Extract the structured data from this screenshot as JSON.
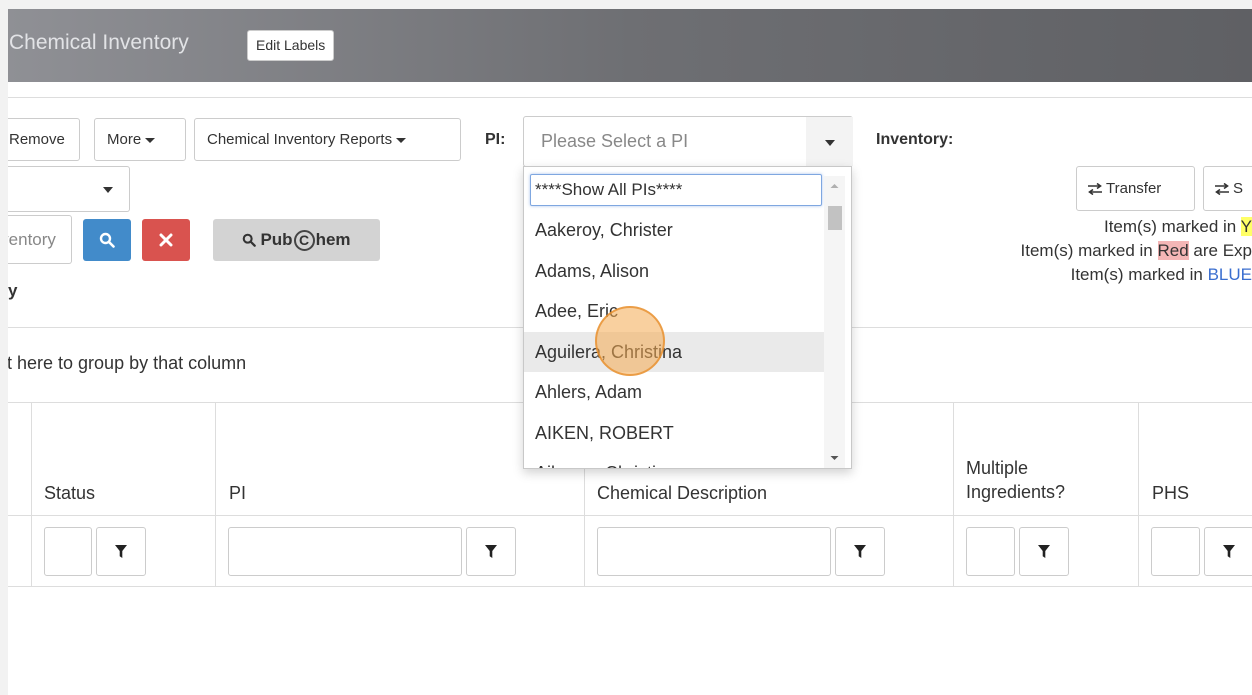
{
  "header": {
    "title": "Chemical Inventory",
    "edit_labels": "Edit Labels"
  },
  "toolbar": {
    "remove": "Remove",
    "more": "More",
    "reports": "Chemical Inventory Reports",
    "pi_label": "PI:",
    "pi_placeholder": "Please Select a PI",
    "inventory_label": "Inventory:"
  },
  "search": {
    "placeholder": "Inventory",
    "search_icon": "search-icon",
    "clear_icon": "times-icon",
    "pubchem_prefix": "Pub",
    "pubchem_c": "C",
    "pubchem_suffix": "hem"
  },
  "side_buttons": {
    "transfer": "Transfer",
    "second": "S"
  },
  "legend": {
    "line1_prefix": "Item(s) marked in ",
    "line1_hl": "Y",
    "line2_prefix": "Item(s) marked in ",
    "line2_hl": "Red",
    "line2_suffix": " are Exp",
    "line3_prefix": "Item(s) marked in ",
    "line3_hl": "BLUE",
    "colors": {
      "yellow": "#ffff66",
      "red": "#f4b6b6",
      "blue": "#3a6ecf"
    }
  },
  "left_fragment": "y",
  "grid": {
    "group_hint": "it here to group by that column",
    "columns": [
      "Status",
      "PI",
      "Chemical Description",
      "Multiple Ingredients?",
      "PHS"
    ]
  },
  "dropdown": {
    "search_value": "****Show All PIs****",
    "items": [
      "Aakeroy, Christer",
      "Adams, Alison",
      "Adee, Eric",
      "Aguilera, Christina",
      "Ahlers, Adam",
      "AIKEN, ROBERT",
      "Aikman, Christine"
    ],
    "hovered_index": 3
  },
  "colors": {
    "primary": "#428bca",
    "danger": "#d9534f",
    "header_bg": "#6e6f73"
  }
}
